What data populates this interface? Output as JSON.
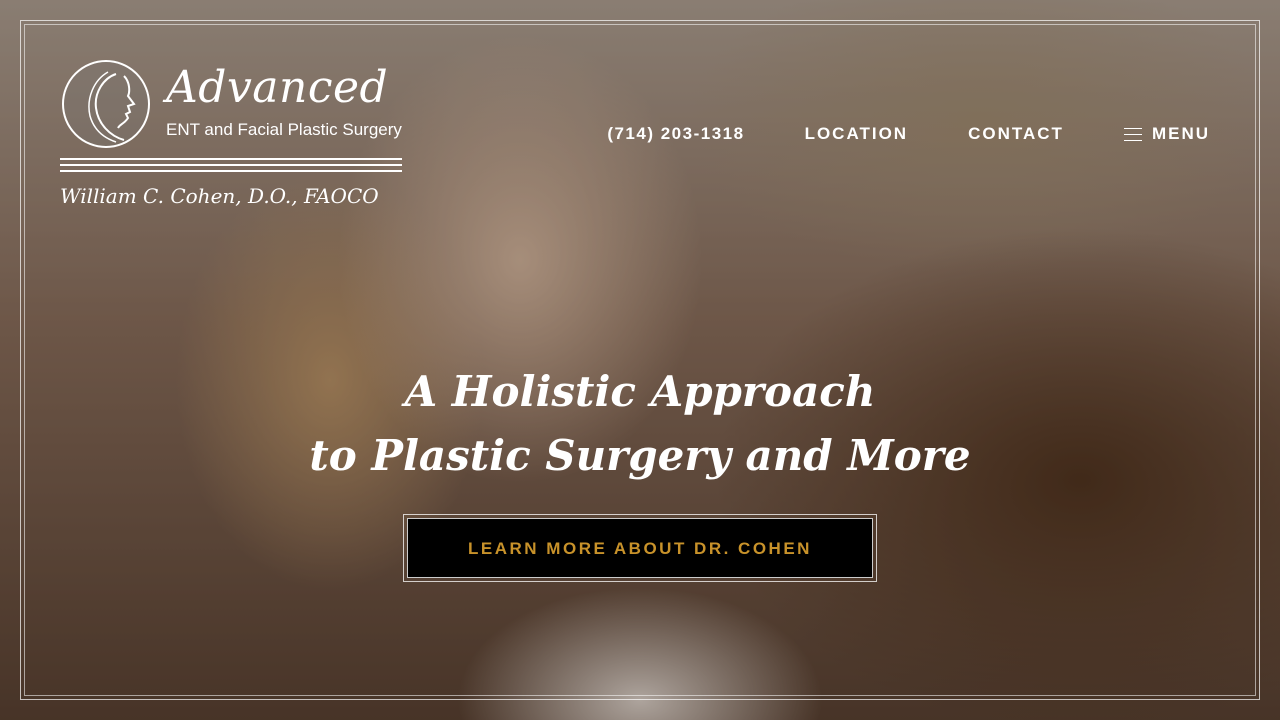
{
  "logo": {
    "name": "Advanced",
    "subtitle": "ENT and Facial Plastic Surgery",
    "doctor": "William C. Cohen, D.O., FAOCO"
  },
  "nav": {
    "phone": "(714) 203-1318",
    "location": "LOCATION",
    "contact": "CONTACT",
    "menu": "MENU"
  },
  "hero": {
    "headline_line1": "A Holistic Approach",
    "headline_line2": "to Plastic Surgery and More",
    "cta_label": "LEARN MORE ABOUT DR. COHEN"
  },
  "colors": {
    "cta_text": "#c8922a",
    "cta_background": "#000000",
    "text": "#ffffff"
  },
  "icons": {
    "menu": "hamburger-icon",
    "logo_emblem": "face-profile-icon"
  }
}
